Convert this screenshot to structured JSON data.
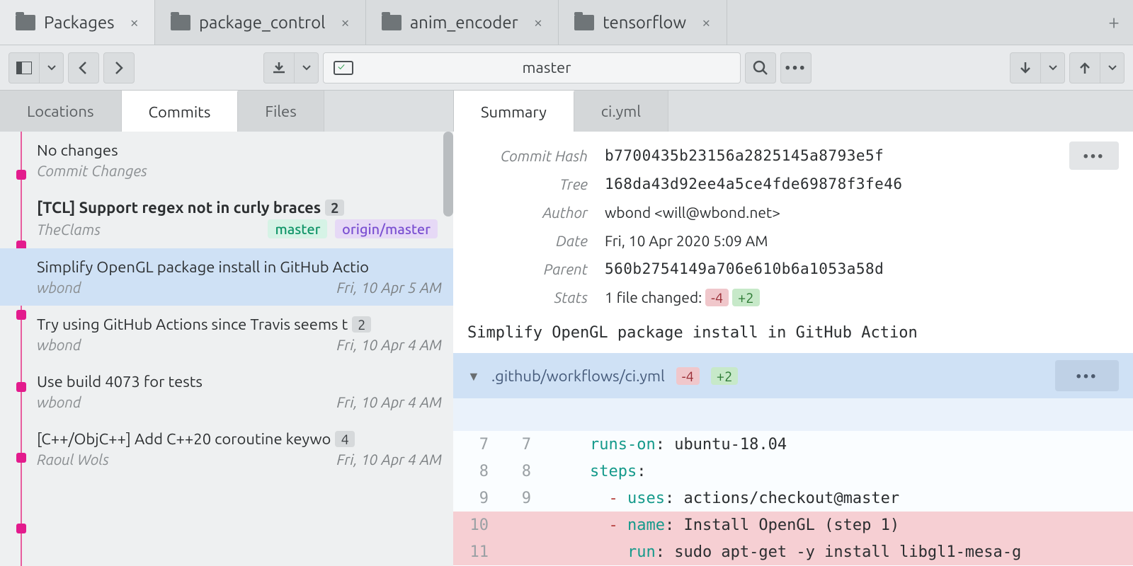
{
  "repo_tabs": [
    {
      "label": "Packages",
      "active": true
    },
    {
      "label": "package_control",
      "active": false
    },
    {
      "label": "anim_encoder",
      "active": false
    },
    {
      "label": "tensorflow",
      "active": false
    }
  ],
  "branch": {
    "name": "master"
  },
  "left_tabs": [
    "Locations",
    "Commits",
    "Files"
  ],
  "left_tab_active": 1,
  "right_tabs": [
    "Summary",
    "ci.yml"
  ],
  "right_tab_active": 0,
  "wc": {
    "title": "No changes",
    "subtitle": "Commit Changes"
  },
  "commits": [
    {
      "title": "[TCL] Support regex not in curly braces",
      "author": "TheClams",
      "date": "",
      "count": "2",
      "bold": true,
      "refs": [
        {
          "name": "master",
          "kind": "local"
        },
        {
          "name": "origin/master",
          "kind": "remote"
        }
      ]
    },
    {
      "title": "Simplify OpenGL package install in GitHub Actio",
      "author": "wbond",
      "date": "Fri, 10 Apr 5 AM",
      "selected": true
    },
    {
      "title": "Try using GitHub Actions since Travis seems t",
      "author": "wbond",
      "date": "Fri, 10 Apr 4 AM",
      "count": "2"
    },
    {
      "title": "Use build 4073 for tests",
      "author": "wbond",
      "date": "Fri, 10 Apr 4 AM"
    },
    {
      "title": "[C++/ObjC++] Add C++20 coroutine keywo",
      "author": "Raoul Wols",
      "date": "Fri, 10 Apr 4 AM",
      "count": "4"
    }
  ],
  "summary": {
    "labels": {
      "hash": "Commit Hash",
      "tree": "Tree",
      "author": "Author",
      "date": "Date",
      "parent": "Parent",
      "stats": "Stats"
    },
    "hash": "b7700435b23156a2825145a8793e5f",
    "tree": "168da43d92ee4a5ce4fde69878f3fe46",
    "author": "wbond <will@wbond.net>",
    "date": "Fri, 10 Apr 2020 5:09 AM",
    "parent": "560b2754149a706e610b6a1053a58d",
    "stats_prefix": "1 file changed: ",
    "stats_minus": "-4",
    "stats_plus": "+2",
    "message": "Simplify OpenGL package install in GitHub Action"
  },
  "file": {
    "path": ".github/workflows/ci.yml",
    "minus": "-4",
    "plus": "+2"
  },
  "diff": {
    "lines": [
      {
        "a": "7",
        "b": "7",
        "kind": "ctx",
        "indent": "    ",
        "key": "runs-on",
        "rest": ": ubuntu-18.04"
      },
      {
        "a": "8",
        "b": "8",
        "kind": "ctx",
        "indent": "    ",
        "key": "steps",
        "rest": ":"
      },
      {
        "a": "9",
        "b": "9",
        "kind": "ctx",
        "indent": "      ",
        "dash": "- ",
        "key": "uses",
        "rest": ": actions/checkout@master"
      },
      {
        "a": "10",
        "b": "",
        "kind": "del",
        "indent": "      ",
        "dash": "- ",
        "key": "name",
        "rest": ": Install OpenGL (step 1)"
      },
      {
        "a": "11",
        "b": "",
        "kind": "del",
        "indent": "        ",
        "key": "run",
        "rest": ": sudo apt-get -y install libgl1-mesa-g"
      }
    ]
  }
}
